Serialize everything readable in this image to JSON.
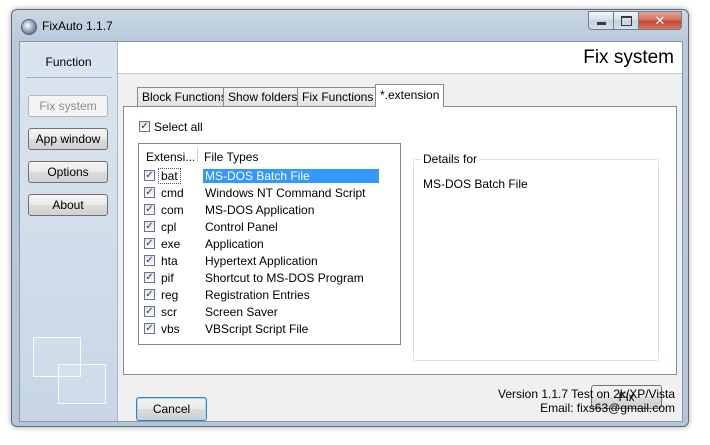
{
  "window": {
    "title": "FixAuto 1.1.7",
    "controls": {
      "minimize": "minimize",
      "maximize": "maximize",
      "close": "✕"
    }
  },
  "sidebar": {
    "title": "Function",
    "buttons": [
      {
        "label": "Fix system",
        "enabled": false
      },
      {
        "label": "App window",
        "enabled": true
      },
      {
        "label": "Options",
        "enabled": true
      },
      {
        "label": "About",
        "enabled": true
      }
    ]
  },
  "header": {
    "title": "Fix system"
  },
  "tabs": [
    {
      "label": "Block Functions",
      "active": false
    },
    {
      "label": "Show folders",
      "active": false
    },
    {
      "label": "Fix Functions",
      "active": false
    },
    {
      "label": "*.extension",
      "active": true
    }
  ],
  "select_all": {
    "label": "Select all",
    "checked": true
  },
  "list": {
    "columns": [
      "Extensi...",
      "File Types"
    ],
    "rows": [
      {
        "ext": "bat",
        "type": "MS-DOS Batch File",
        "checked": true,
        "selected": true
      },
      {
        "ext": "cmd",
        "type": "Windows NT Command Script",
        "checked": true,
        "selected": false
      },
      {
        "ext": "com",
        "type": "MS-DOS Application",
        "checked": true,
        "selected": false
      },
      {
        "ext": "cpl",
        "type": "Control Panel",
        "checked": true,
        "selected": false
      },
      {
        "ext": "exe",
        "type": "Application",
        "checked": true,
        "selected": false
      },
      {
        "ext": "hta",
        "type": "Hypertext Application",
        "checked": true,
        "selected": false
      },
      {
        "ext": "pif",
        "type": "Shortcut to MS-DOS Program",
        "checked": true,
        "selected": false
      },
      {
        "ext": "reg",
        "type": "Registration Entries",
        "checked": true,
        "selected": false
      },
      {
        "ext": "scr",
        "type": "Screen Saver",
        "checked": true,
        "selected": false
      },
      {
        "ext": "vbs",
        "type": "VBScript Script File",
        "checked": true,
        "selected": false
      }
    ]
  },
  "details": {
    "legend": "Details for",
    "text": "MS-DOS Batch File"
  },
  "buttons": {
    "fix": "Fix",
    "cancel": "Cancel"
  },
  "footer": {
    "version": "Version 1.1.7 Test on 2k/XP/Vista",
    "email": "Email: fixs63@gmail.com"
  }
}
